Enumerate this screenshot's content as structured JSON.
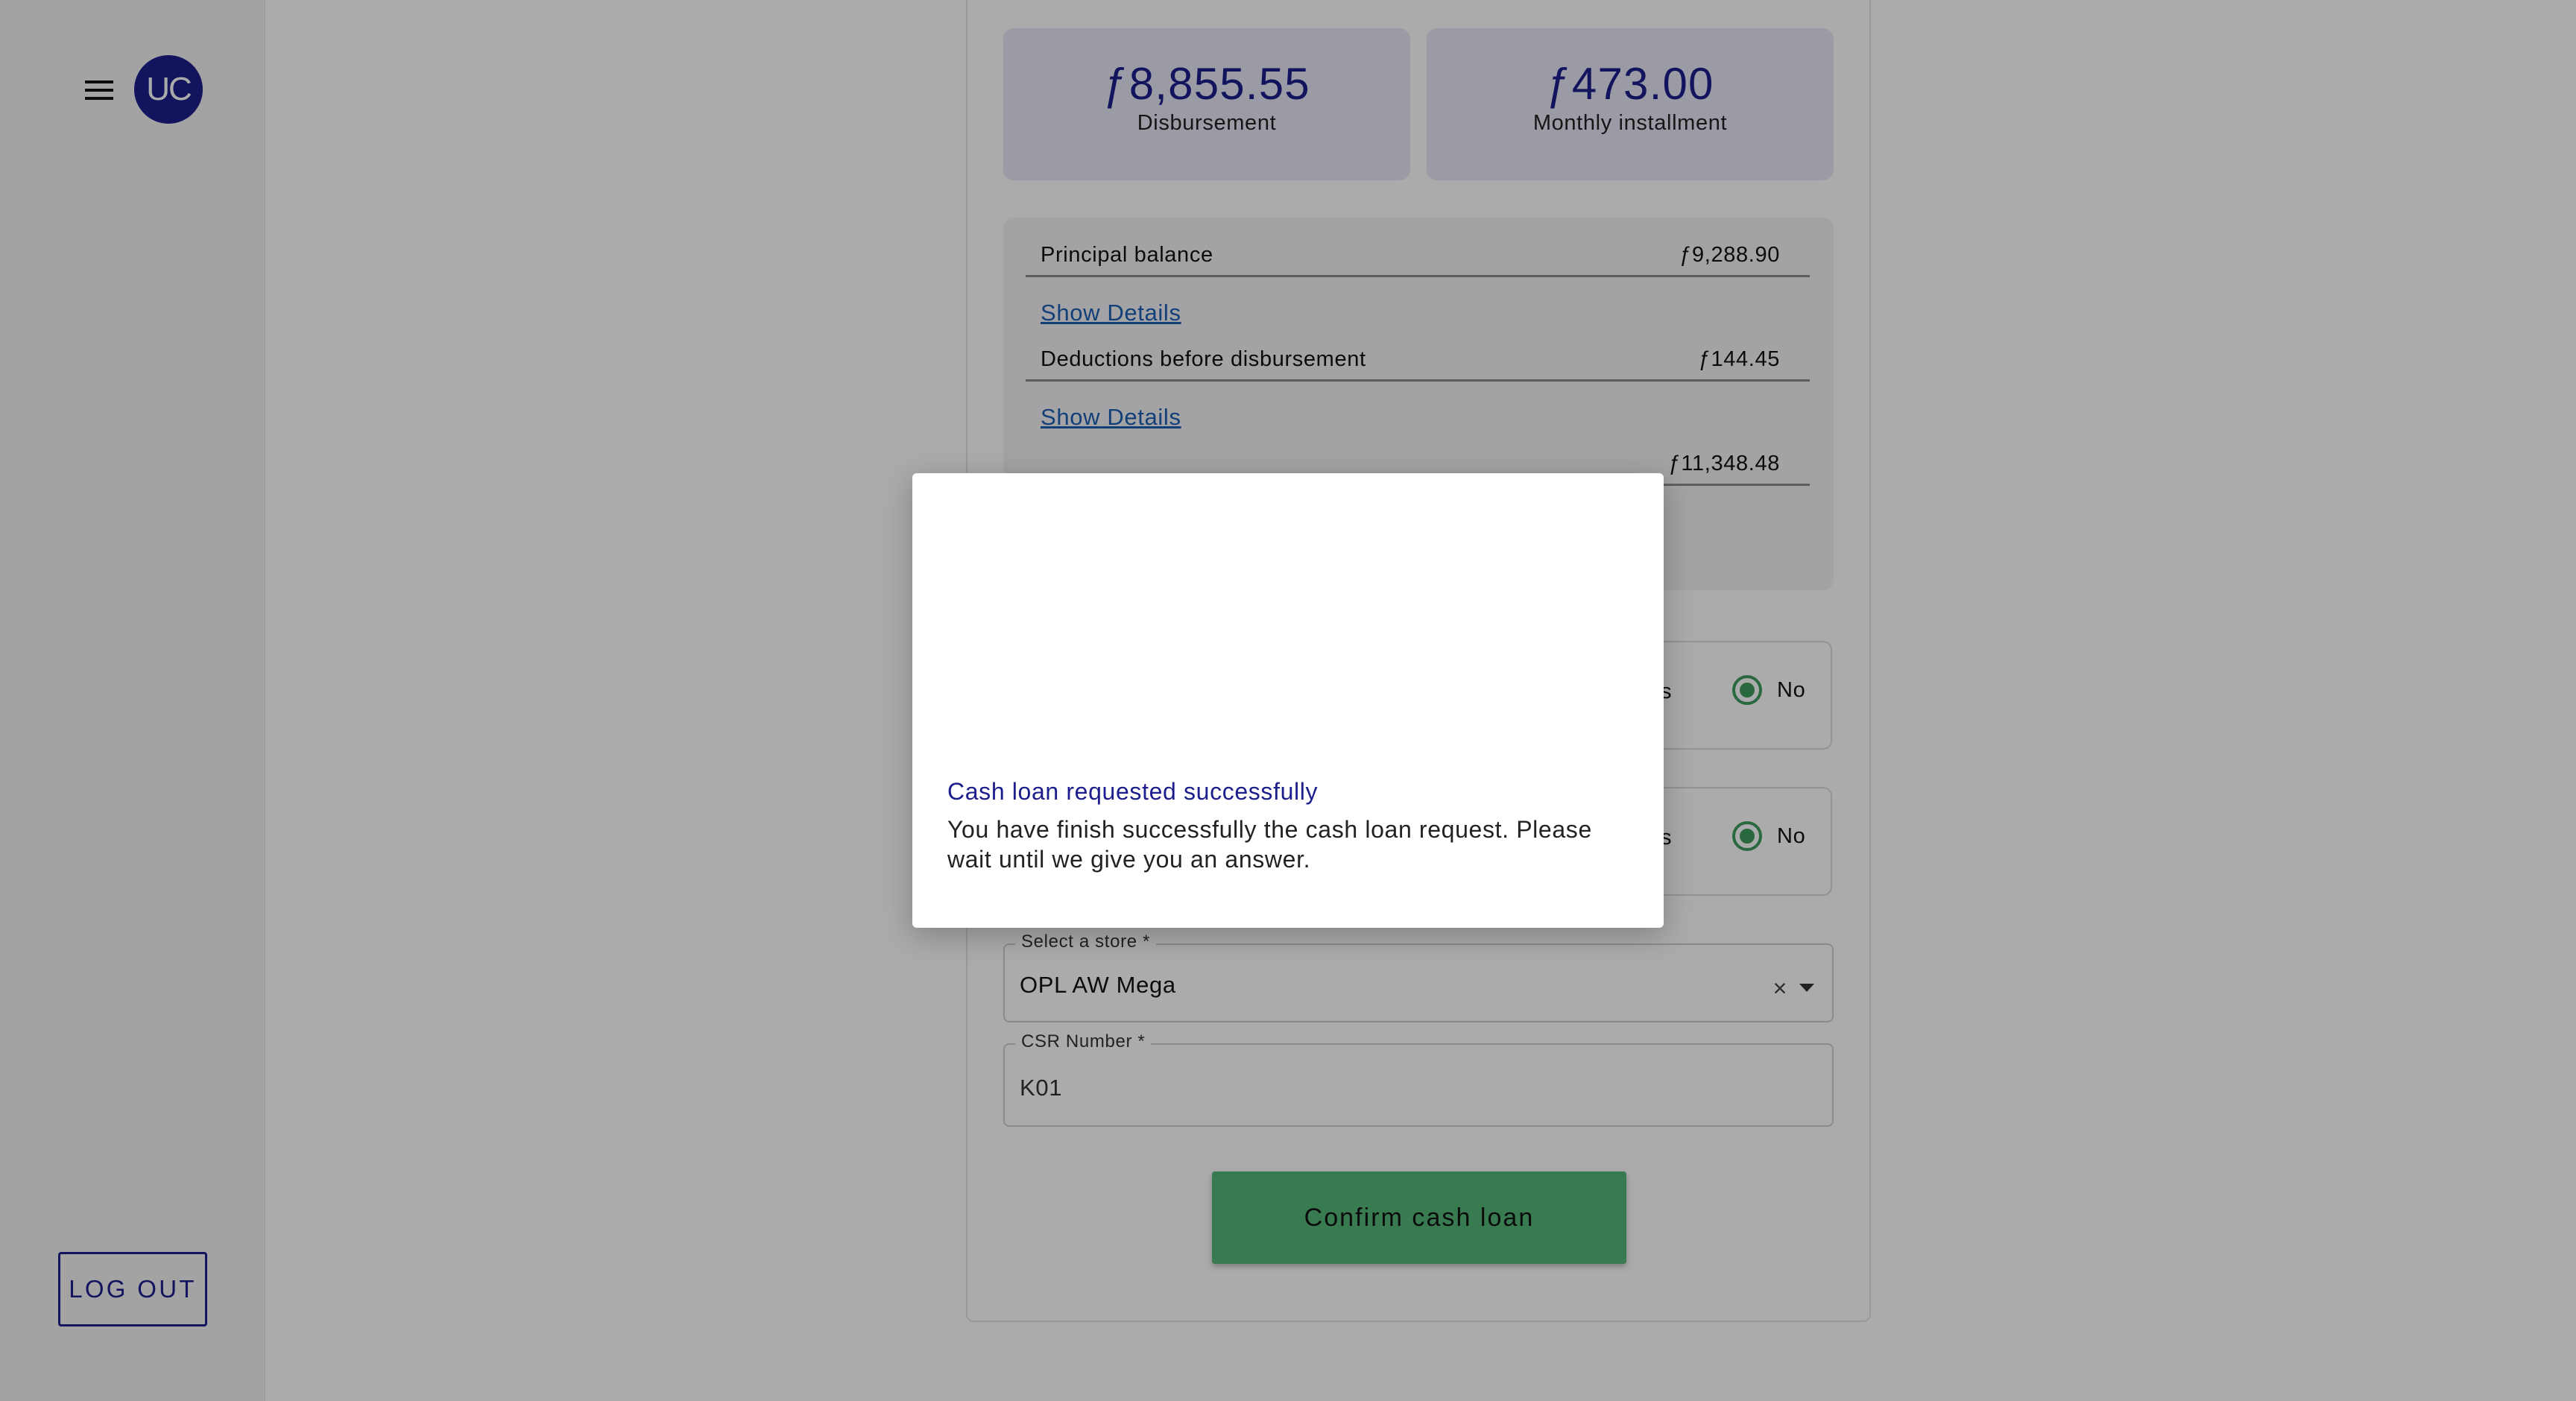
{
  "sidebar": {
    "avatar_initials": "UC",
    "logout_label": "LOG OUT"
  },
  "summary": {
    "disbursement_amount": "ƒ8,855.55",
    "disbursement_label": "Disbursement",
    "installment_amount": "ƒ473.00",
    "installment_label": "Monthly installment"
  },
  "details": {
    "principal_label": "Principal balance",
    "principal_value": "ƒ9,288.90",
    "show_details_1": "Show Details",
    "deductions_label": "Deductions before disbursement",
    "deductions_value": "ƒ144.45",
    "show_details_2": "Show Details",
    "total_value": "ƒ11,348.48"
  },
  "questions": [
    {
      "yes_partial": "s",
      "no_label": "No",
      "selected": "No"
    },
    {
      "yes_partial": "s",
      "no_label": "No",
      "selected": "No"
    }
  ],
  "store_field": {
    "label": "Select a store *",
    "value": "OPL AW Mega",
    "clear_icon": "×"
  },
  "csr_field": {
    "label": "CSR Number *",
    "value": "K01"
  },
  "confirm_label": "Confirm cash loan",
  "modal": {
    "title": "Cash loan requested successfully",
    "body": "You have finish successfully the cash loan request. Please wait until we give you an answer."
  },
  "colors": {
    "brand": "#1b1e8c",
    "accent_green": "#55b87a",
    "link": "#1d5fb5"
  }
}
